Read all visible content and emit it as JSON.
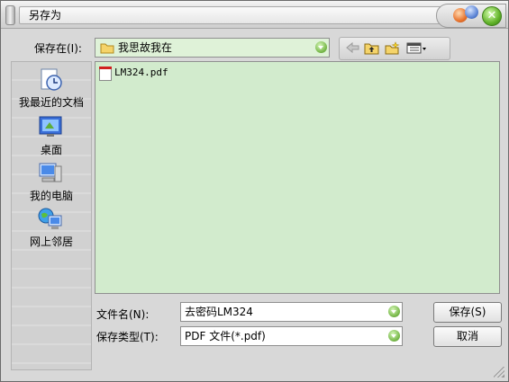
{
  "window": {
    "title": "另存为"
  },
  "save_in": {
    "label": "保存在(I):",
    "value": "我思故我在"
  },
  "toolbar": {
    "icons": [
      "back-icon",
      "up-folder-icon",
      "new-folder-icon",
      "view-menu-icon"
    ]
  },
  "places": [
    {
      "label": "我最近的文档",
      "icon": "recent-documents-icon"
    },
    {
      "label": "桌面",
      "icon": "desktop-icon"
    },
    {
      "label": "我的电脑",
      "icon": "my-computer-icon"
    },
    {
      "label": "网上邻居",
      "icon": "network-places-icon"
    }
  ],
  "files": [
    {
      "name": "LM324.pdf",
      "icon": "pdf-file-icon"
    }
  ],
  "filename": {
    "label": "文件名(N):",
    "value": "去密码LM324"
  },
  "filetype": {
    "label": "保存类型(T):",
    "value": "PDF 文件(*.pdf)"
  },
  "buttons": {
    "save": "保存(S)",
    "cancel": "取消"
  },
  "colors": {
    "field_green": "#dff2d8",
    "list_green": "#d2ebcd",
    "dialog_gray": "#d8d8d8"
  }
}
